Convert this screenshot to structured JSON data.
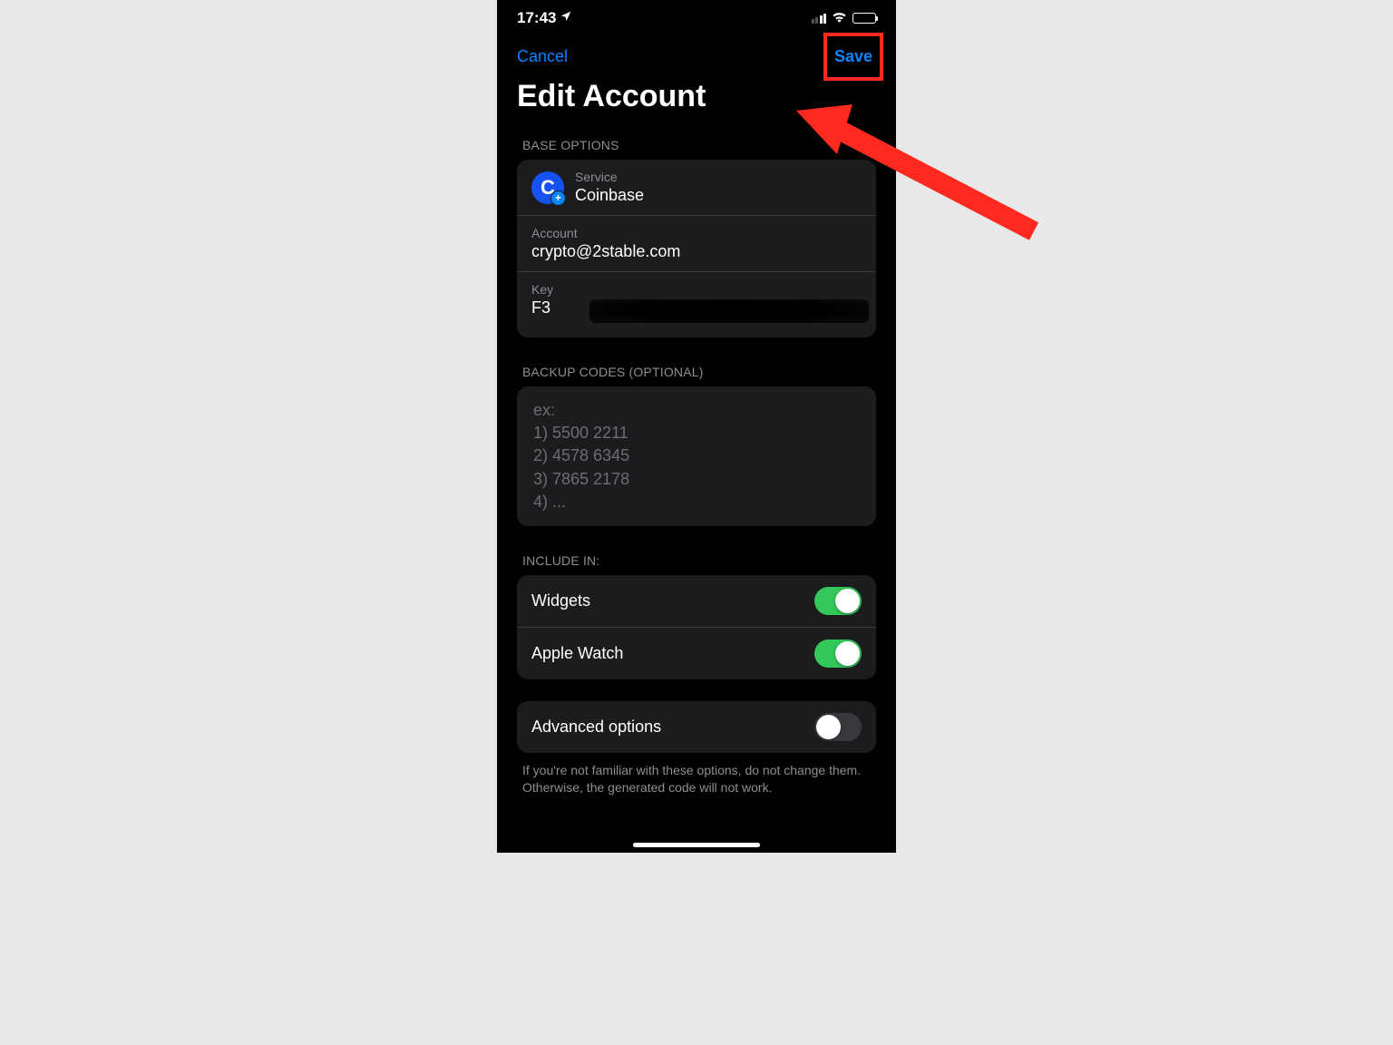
{
  "status": {
    "time": "17:43"
  },
  "nav": {
    "cancel": "Cancel",
    "save": "Save"
  },
  "title": "Edit Account",
  "sections": {
    "base_options_header": "BASE OPTIONS",
    "backup_header": "BACKUP CODES (OPTIONAL)",
    "include_header": "INCLUDE IN:"
  },
  "base": {
    "service_label": "Service",
    "service_value": "Coinbase",
    "account_label": "Account",
    "account_value": "crypto@2stable.com",
    "key_label": "Key",
    "key_value": "F3"
  },
  "backup": {
    "placeholder": "ex:\n1) 5500 2211\n2) 4578 6345\n3) 7865 2178\n4) ..."
  },
  "include": {
    "widgets_label": "Widgets",
    "applewatch_label": "Apple Watch"
  },
  "advanced": {
    "label": "Advanced options",
    "footnote": "If you're not familiar with these options, do not change them. Otherwise, the generated code will not work."
  }
}
